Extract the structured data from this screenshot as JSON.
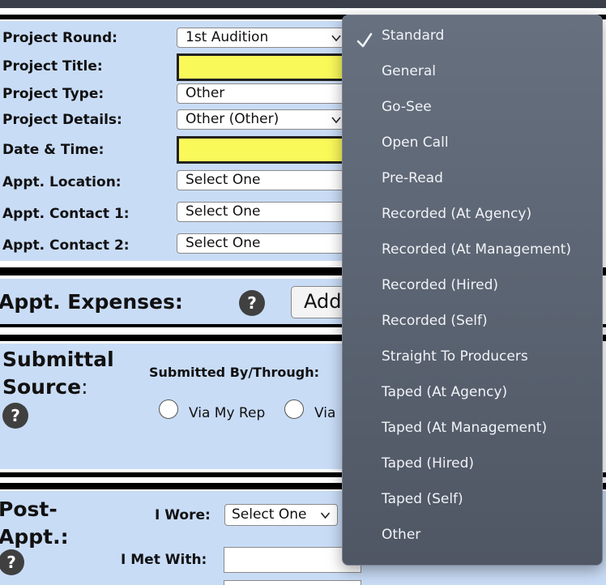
{
  "form": {
    "project_round_label": "Project Round:",
    "project_round_value": "1st Audition",
    "project_title_label": "Project Title:",
    "project_type_label": "Project Type:",
    "project_type_value": "Other",
    "project_details_label": "Project Details:",
    "project_details_value": "Other (Other)",
    "date_time_label": "Date & Time:",
    "appt_location_label": "Appt. Location:",
    "appt_location_value": "Select One",
    "appt_contact1_label": "Appt. Contact 1:",
    "appt_contact1_value": "Select One",
    "appt_contact2_label": "Appt. Contact 2:",
    "appt_contact2_value": "Select One"
  },
  "expenses": {
    "title": "Appt. Expenses:",
    "help_glyph": "?",
    "add_button_label": "Add"
  },
  "submittal": {
    "title_line1": "Submittal",
    "title_line2": "Source",
    "title_colon": ":",
    "help_glyph": "?",
    "submitted_by_label": "Submitted By/Through:",
    "radio1_label": "Via My Rep",
    "radio2_label": "Via"
  },
  "post_appt": {
    "title_line1": "Post-",
    "title_line2": "Appt.:",
    "help_glyph": "?",
    "i_wore_label": "I Wore:",
    "i_wore_value": "Select One",
    "i_met_with_label": "I Met With:"
  },
  "dropdown": {
    "selected": "Standard",
    "options": [
      "Standard",
      "General",
      "Go-See",
      "Open Call",
      "Pre-Read",
      "Recorded (At Agency)",
      "Recorded (At Management)",
      "Recorded (Hired)",
      "Recorded (Self)",
      "Straight To Producers",
      "Taped (At Agency)",
      "Taped (At Management)",
      "Taped (Hired)",
      "Taped (Self)",
      "Other"
    ]
  },
  "colors": {
    "panel": "#c9dcf6",
    "highlight_field": "#faf95a",
    "menu_bg": "#5b6472",
    "menu_text": "#f1f3f6"
  }
}
